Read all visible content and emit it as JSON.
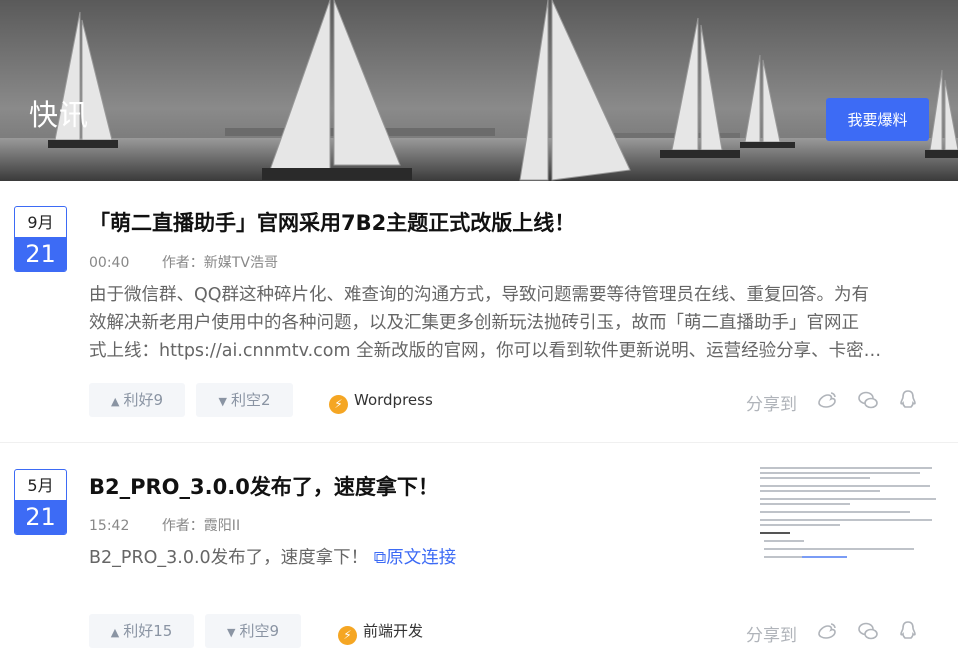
{
  "banner": {
    "title": "快讯",
    "tip_button": "我要爆料"
  },
  "posts": [
    {
      "month": "9月",
      "day": "21",
      "title": "「萌二直播助手」官网采用7B2主题正式改版上线！",
      "time": "00:40",
      "author": "作者：新媒TV浩哥",
      "excerpt_lines": [
        "由于微信群、QQ群这种碎片化、难查询的沟通方式，导致问题需要等待管理员在线、重复回答。为有",
        "效解决新老用户使用中的各种问题，以及汇集更多创新玩法抛砖引玉，故而「萌二直播助手」官网正",
        "式上线：https://ai.cnnmtv.com 全新改版的官网，你可以看到软件更新说明、运营经验分享、卡密…"
      ],
      "upvote": "利好9",
      "downvote": "利空2",
      "category": "Wordpress",
      "share_label": "分享到"
    },
    {
      "month": "5月",
      "day": "21",
      "title": "B2_PRO_3.0.0发布了，速度拿下！",
      "time": "15:42",
      "author": "作者：霞阳II",
      "excerpt": "B2_PRO_3.0.0发布了，速度拿下！",
      "source_link": "原文连接",
      "upvote": "利好15",
      "downvote": "利空9",
      "category": "前端开发",
      "share_label": "分享到"
    }
  ],
  "icons": {
    "up": "triangle-up-icon",
    "down": "triangle-down-icon",
    "category": "lightning-icon",
    "weibo": "weibo-icon",
    "wechat": "wechat-icon",
    "qq": "qq-icon",
    "link": "external-link-icon"
  },
  "colors": {
    "accent": "#3d6bf5",
    "category_icon": "#f5a623"
  }
}
